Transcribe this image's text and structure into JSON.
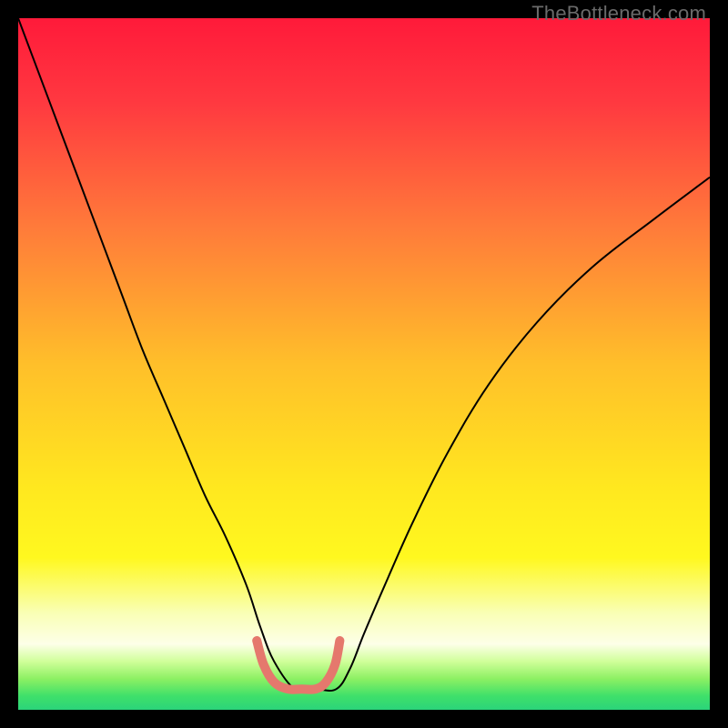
{
  "watermark": "TheBottleneck.com",
  "chart_data": {
    "type": "line",
    "title": "",
    "xlabel": "",
    "ylabel": "",
    "xlim": [
      0,
      100
    ],
    "ylim": [
      0,
      100
    ],
    "grid": false,
    "legend": false,
    "background_gradient": {
      "stops": [
        {
          "offset": 0.0,
          "color": "#ff1a3a"
        },
        {
          "offset": 0.12,
          "color": "#ff3840"
        },
        {
          "offset": 0.3,
          "color": "#ff7a3a"
        },
        {
          "offset": 0.5,
          "color": "#ffbf2a"
        },
        {
          "offset": 0.68,
          "color": "#ffe81f"
        },
        {
          "offset": 0.78,
          "color": "#fff81f"
        },
        {
          "offset": 0.86,
          "color": "#f9ffb5"
        },
        {
          "offset": 0.905,
          "color": "#fdffe8"
        },
        {
          "offset": 0.93,
          "color": "#d0ff9a"
        },
        {
          "offset": 0.955,
          "color": "#8df063"
        },
        {
          "offset": 0.98,
          "color": "#3fe06a"
        },
        {
          "offset": 1.0,
          "color": "#2bd47a"
        }
      ]
    },
    "series": [
      {
        "name": "bottleneck-curve",
        "color": "#000000",
        "x": [
          0,
          3,
          6,
          9,
          12,
          15,
          18,
          21,
          24,
          27,
          30,
          33,
          35,
          37,
          40,
          43,
          46,
          48,
          50,
          53,
          57,
          62,
          68,
          75,
          83,
          92,
          100
        ],
        "y": [
          100,
          92,
          84,
          76,
          68,
          60,
          52,
          45,
          38,
          31,
          25,
          18,
          12,
          7,
          3,
          3,
          3,
          6,
          11,
          18,
          27,
          37,
          47,
          56,
          64,
          71,
          77
        ]
      },
      {
        "name": "valley-highlight",
        "color": "#e5786d",
        "width": 10,
        "linecap": "round",
        "x": [
          34.5,
          35.5,
          37,
          39,
          41,
          43,
          44.5,
          45.8,
          46.5
        ],
        "y": [
          10,
          6.5,
          4,
          3,
          3,
          3,
          4,
          6.5,
          10
        ]
      }
    ]
  }
}
